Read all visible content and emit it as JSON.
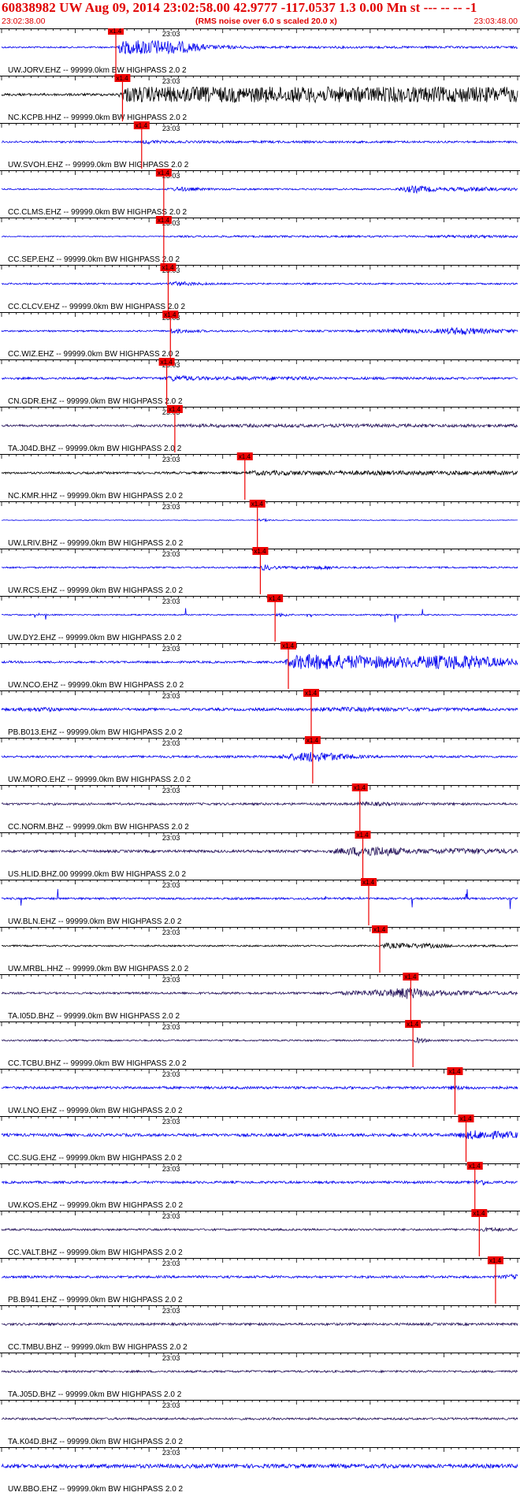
{
  "header": {
    "title": "60838982 UW Aug 09, 2014 23:02:58.00   42.9777 -117.0537  1.3 0.00 Mn st --- -- --   -1",
    "subtitle": "(RMS noise over 6.0 s scaled 20.0 x)",
    "time_start": "23:02:38.00",
    "time_end": "23:03:48.00"
  },
  "chart_data": {
    "type": "line",
    "title": "60838982 UW Aug 09, 2014 23:02:58.00   42.9777 -117.0537  1.3 0.00 Mn st --- -- --   -1",
    "subtitle": "(RMS noise over 6.0 s scaled 20.0 x)",
    "x_range": [
      "23:02:38.00",
      "23:03:48.00"
    ],
    "time_tick_label": "23:03",
    "pick_label": "x1.4",
    "colors": {
      "blue": "#0000ee",
      "black": "#000000",
      "purple": "#24125a",
      "pick": "#ee0000",
      "accent": "#e00000"
    },
    "traces": [
      {
        "station": "UW.JORV.EHZ -- 99999.0km BW  HIGHPASS  2.0  2",
        "pick_s": 15.5,
        "color": "blue",
        "env": [
          [
            0,
            1.0
          ],
          [
            15.5,
            1.0
          ],
          [
            16,
            8
          ],
          [
            20,
            10
          ],
          [
            24,
            8
          ],
          [
            28,
            3
          ],
          [
            35,
            1.4
          ],
          [
            70,
            1.4
          ]
        ]
      },
      {
        "station": "NC.KCPB.HHZ -- 99999.0km BW  HIGHPASS  2.0  2",
        "pick_s": 16.4,
        "color": "black",
        "env": [
          [
            0,
            1.5
          ],
          [
            15.8,
            1.5
          ],
          [
            16.6,
            10
          ],
          [
            70,
            10
          ]
        ]
      },
      {
        "station": "UW.SVOH.EHZ -- 99999.0km BW  HIGHPASS  2.0  2",
        "pick_s": 19.0,
        "color": "blue",
        "env": [
          [
            0,
            1.2
          ],
          [
            19,
            1.2
          ],
          [
            19.5,
            3
          ],
          [
            22,
            1.5
          ],
          [
            70,
            1.2
          ]
        ]
      },
      {
        "station": "CC.CLMS.EHZ -- 99999.0km BW  HIGHPASS  2.0  2",
        "pick_s": 22.0,
        "color": "blue",
        "env": [
          [
            0,
            0.8
          ],
          [
            22,
            0.8
          ],
          [
            24,
            3
          ],
          [
            28,
            1.2
          ],
          [
            53,
            1.0
          ],
          [
            56,
            5
          ],
          [
            60,
            2
          ],
          [
            64,
            3
          ],
          [
            70,
            1.5
          ]
        ]
      },
      {
        "station": "CC.SEP.EHZ -- 99999.0km BW  HIGHPASS  2.0  2",
        "pick_s": 22.0,
        "color": "blue",
        "env": [
          [
            0,
            0.6
          ],
          [
            22,
            0.6
          ],
          [
            25,
            1.2
          ],
          [
            58,
            1.2
          ],
          [
            62,
            2
          ],
          [
            70,
            1.5
          ]
        ]
      },
      {
        "station": "CC.CLCV.EHZ -- 99999.0km BW  HIGHPASS  2.0  2",
        "pick_s": 22.6,
        "color": "blue",
        "env": [
          [
            0,
            1.0
          ],
          [
            22.6,
            1.0
          ],
          [
            23,
            3.5
          ],
          [
            26,
            2
          ],
          [
            30,
            1
          ],
          [
            70,
            1
          ]
        ]
      },
      {
        "station": "CC.WIZ.EHZ -- 99999.0km BW  HIGHPASS  2.0  2",
        "pick_s": 22.9,
        "color": "blue",
        "env": [
          [
            0,
            1.0
          ],
          [
            22.9,
            1.0
          ],
          [
            23,
            3
          ],
          [
            28,
            1.2
          ],
          [
            48,
            1.2
          ],
          [
            55,
            3
          ],
          [
            58,
            2
          ],
          [
            62,
            5
          ],
          [
            66,
            3
          ],
          [
            70,
            2
          ]
        ]
      },
      {
        "station": "CN.GDR.EHZ -- 99999.0km BW  HIGHPASS  2.0  2",
        "pick_s": 22.4,
        "color": "blue",
        "env": [
          [
            0,
            1.3
          ],
          [
            22,
            1.5
          ],
          [
            23,
            4
          ],
          [
            28,
            2
          ],
          [
            40,
            2.5
          ],
          [
            44,
            1.8
          ],
          [
            70,
            1.3
          ]
        ]
      },
      {
        "station": "TA.J04D.BHZ -- 99999.0km BW  HIGHPASS  2.0  2",
        "pick_s": 23.5,
        "color": "purple",
        "env": [
          [
            0,
            1.3
          ],
          [
            23.5,
            1.5
          ],
          [
            25,
            2.2
          ],
          [
            70,
            2.0
          ]
        ]
      },
      {
        "station": "NC.KMR.HHZ -- 99999.0km BW  HIGHPASS  2.0  2",
        "pick_s": 33.0,
        "color": "black",
        "env": [
          [
            0,
            1.2
          ],
          [
            33,
            1.5
          ],
          [
            34,
            3
          ],
          [
            70,
            2.5
          ]
        ]
      },
      {
        "station": "UW.LRIV.BHZ -- 99999.0km BW  HIGHPASS  2.0  2",
        "pick_s": 34.7,
        "color": "blue",
        "env": [
          [
            0,
            0.4
          ],
          [
            34.7,
            0.4
          ],
          [
            35,
            2
          ],
          [
            37,
            0.6
          ],
          [
            70,
            0.4
          ]
        ]
      },
      {
        "station": "UW.RCS.EHZ -- 99999.0km BW  HIGHPASS  2.0  2",
        "pick_s": 35.1,
        "color": "blue",
        "env": [
          [
            0,
            1.0
          ],
          [
            35,
            1.0
          ],
          [
            35.5,
            4
          ],
          [
            38,
            1.3
          ],
          [
            44,
            2.5
          ],
          [
            46,
            1.2
          ],
          [
            70,
            1.0
          ]
        ]
      },
      {
        "station": "UW.DY2.EHZ -- 99999.0km BW  HIGHPASS  2.0  2",
        "pick_s": 37.1,
        "color": "blue",
        "env": [
          [
            0,
            0.8
          ],
          [
            37,
            0.8
          ],
          [
            38,
            2.5
          ],
          [
            40,
            0.8
          ],
          [
            70,
            0.8
          ]
        ]
      },
      {
        "station": "UW.NCO.EHZ -- 99999.0km BW  HIGHPASS  2.0  2",
        "pick_s": 38.9,
        "color": "blue",
        "env": [
          [
            0,
            1.3
          ],
          [
            38,
            1.3
          ],
          [
            40,
            10
          ],
          [
            47,
            9
          ],
          [
            55,
            7
          ],
          [
            62,
            10
          ],
          [
            67,
            6
          ],
          [
            70,
            4
          ]
        ]
      },
      {
        "station": "PB.B013.EHZ -- 99999.0km BW  HIGHPASS  2.0  2",
        "pick_s": 42.0,
        "color": "blue",
        "env": [
          [
            0,
            1.5
          ],
          [
            6,
            3
          ],
          [
            10,
            1.5
          ],
          [
            42,
            1.8
          ],
          [
            44,
            3
          ],
          [
            70,
            1.5
          ]
        ]
      },
      {
        "station": "UW.MORO.EHZ -- 99999.0km BW  HIGHPASS  2.0  2",
        "pick_s": 42.2,
        "color": "blue",
        "env": [
          [
            0,
            1.3
          ],
          [
            37,
            1.5
          ],
          [
            42,
            7
          ],
          [
            46,
            4
          ],
          [
            50,
            1.6
          ],
          [
            70,
            1.3
          ]
        ]
      },
      {
        "station": "CC.NORM.BHZ -- 99999.0km BW  HIGHPASS  2.0  2",
        "pick_s": 48.6,
        "color": "purple",
        "env": [
          [
            0,
            1.3
          ],
          [
            48,
            1.5
          ],
          [
            49,
            3
          ],
          [
            54,
            1.7
          ],
          [
            70,
            1.3
          ]
        ]
      },
      {
        "station": "US.HLID.BHZ.00 99999.0km BW  HIGHPASS  2.0  2",
        "pick_s": 49.0,
        "color": "purple",
        "env": [
          [
            0,
            1.5
          ],
          [
            44,
            1.7
          ],
          [
            49,
            7
          ],
          [
            52,
            6
          ],
          [
            56,
            3
          ],
          [
            63,
            4
          ],
          [
            70,
            2.5
          ]
        ]
      },
      {
        "station": "UW.BLN.EHZ -- 99999.0km BW  HIGHPASS  2.0  2",
        "pick_s": 49.8,
        "color": "blue",
        "env": [
          [
            0,
            1.3
          ],
          [
            70,
            1.3
          ]
        ]
      },
      {
        "station": "UW.MRBL.HHZ -- 99999.0km BW  HIGHPASS  2.0  2",
        "pick_s": 51.3,
        "color": "black",
        "env": [
          [
            0,
            1.0
          ],
          [
            51,
            1.0
          ],
          [
            52,
            3.5
          ],
          [
            58,
            3
          ],
          [
            62,
            1.5
          ],
          [
            70,
            1.2
          ]
        ]
      },
      {
        "station": "TA.I05D.BHZ -- 99999.0km BW  HIGHPASS  2.0  2",
        "pick_s": 55.5,
        "color": "purple",
        "env": [
          [
            0,
            1.2
          ],
          [
            44,
            1.5
          ],
          [
            48,
            3
          ],
          [
            53,
            5
          ],
          [
            55,
            8
          ],
          [
            58,
            4
          ],
          [
            62,
            3
          ],
          [
            70,
            2
          ]
        ]
      },
      {
        "station": "CC.TCBU.BHZ -- 99999.0km BW  HIGHPASS  2.0  2",
        "pick_s": 55.8,
        "color": "purple",
        "env": [
          [
            0,
            1.0
          ],
          [
            55.8,
            1.0
          ],
          [
            56.5,
            4
          ],
          [
            58,
            1.3
          ],
          [
            70,
            1.0
          ]
        ]
      },
      {
        "station": "UW.LNO.EHZ -- 99999.0km BW  HIGHPASS  2.0  2",
        "pick_s": 61.5,
        "color": "blue",
        "env": [
          [
            0,
            1.6
          ],
          [
            60,
            1.6
          ],
          [
            61.5,
            3
          ],
          [
            64,
            1.8
          ],
          [
            70,
            1.6
          ]
        ]
      },
      {
        "station": "CC.SUG.EHZ -- 99999.0km BW  HIGHPASS  2.0  2",
        "pick_s": 63.0,
        "color": "blue",
        "env": [
          [
            0,
            1.7
          ],
          [
            61,
            2
          ],
          [
            64,
            6
          ],
          [
            67,
            5
          ],
          [
            70,
            4
          ]
        ]
      },
      {
        "station": "UW.KOS.EHZ -- 99999.0km BW  HIGHPASS  2.0  2",
        "pick_s": 64.2,
        "color": "blue",
        "env": [
          [
            0,
            1.5
          ],
          [
            64,
            1.5
          ],
          [
            64.8,
            5
          ],
          [
            66,
            2
          ],
          [
            70,
            1.5
          ]
        ]
      },
      {
        "station": "CC.VALT.BHZ -- 99999.0km BW  HIGHPASS  2.0  2",
        "pick_s": 64.8,
        "color": "purple",
        "env": [
          [
            0,
            1.2
          ],
          [
            64.5,
            1.3
          ],
          [
            66,
            3
          ],
          [
            68,
            2
          ],
          [
            70,
            1.8
          ]
        ]
      },
      {
        "station": "PB.B941.EHZ -- 99999.0km BW  HIGHPASS  2.0  2",
        "pick_s": 67.0,
        "color": "blue",
        "env": [
          [
            0,
            1.5
          ],
          [
            67,
            1.5
          ],
          [
            69,
            3
          ],
          [
            70,
            3
          ]
        ]
      },
      {
        "station": "CC.TMBU.BHZ -- 99999.0km BW  HIGHPASS  2.0  2",
        "pick_s": null,
        "color": "purple",
        "env": [
          [
            0,
            1.5
          ],
          [
            70,
            1.5
          ]
        ]
      },
      {
        "station": "TA.J05D.BHZ -- 99999.0km BW  HIGHPASS  2.0  2",
        "pick_s": null,
        "color": "purple",
        "env": [
          [
            0,
            1.3
          ],
          [
            70,
            1.3
          ]
        ]
      },
      {
        "station": "TA.K04D.BHZ -- 99999.0km BW  HIGHPASS  2.0  2",
        "pick_s": null,
        "color": "purple",
        "env": [
          [
            0,
            1.3
          ],
          [
            70,
            1.3
          ]
        ]
      },
      {
        "station": "UW.BBO.EHZ -- 99999.0km BW  HIGHPASS  2.0  2",
        "pick_s": null,
        "color": "blue",
        "env": [
          [
            0,
            2.5
          ],
          [
            70,
            2.5
          ]
        ]
      }
    ]
  }
}
